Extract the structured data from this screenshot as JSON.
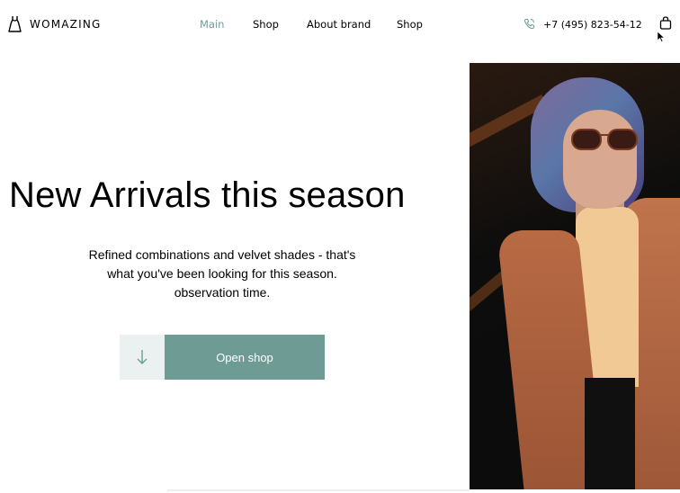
{
  "brand": {
    "name": "WOMAZING"
  },
  "nav": {
    "items": [
      {
        "label": "Main",
        "active": true
      },
      {
        "label": "Shop",
        "active": false
      },
      {
        "label": "About brand",
        "active": false
      },
      {
        "label": "Shop",
        "active": false
      }
    ]
  },
  "contact": {
    "phone": "+7 (495) 823-54-12"
  },
  "hero": {
    "title": "New Arrivals this season",
    "text": "Refined combinations and velvet shades - that's what you've been looking for this season. observation time.",
    "button_label": "Open shop"
  },
  "icons": {
    "logo": "dress-icon",
    "phone": "phone-icon",
    "cart": "bag-icon",
    "scroll": "arrow-down-icon"
  },
  "colors": {
    "accent": "#6e9c94",
    "accent_light": "#eaf1f0",
    "nav_active": "#6e9c9f"
  }
}
